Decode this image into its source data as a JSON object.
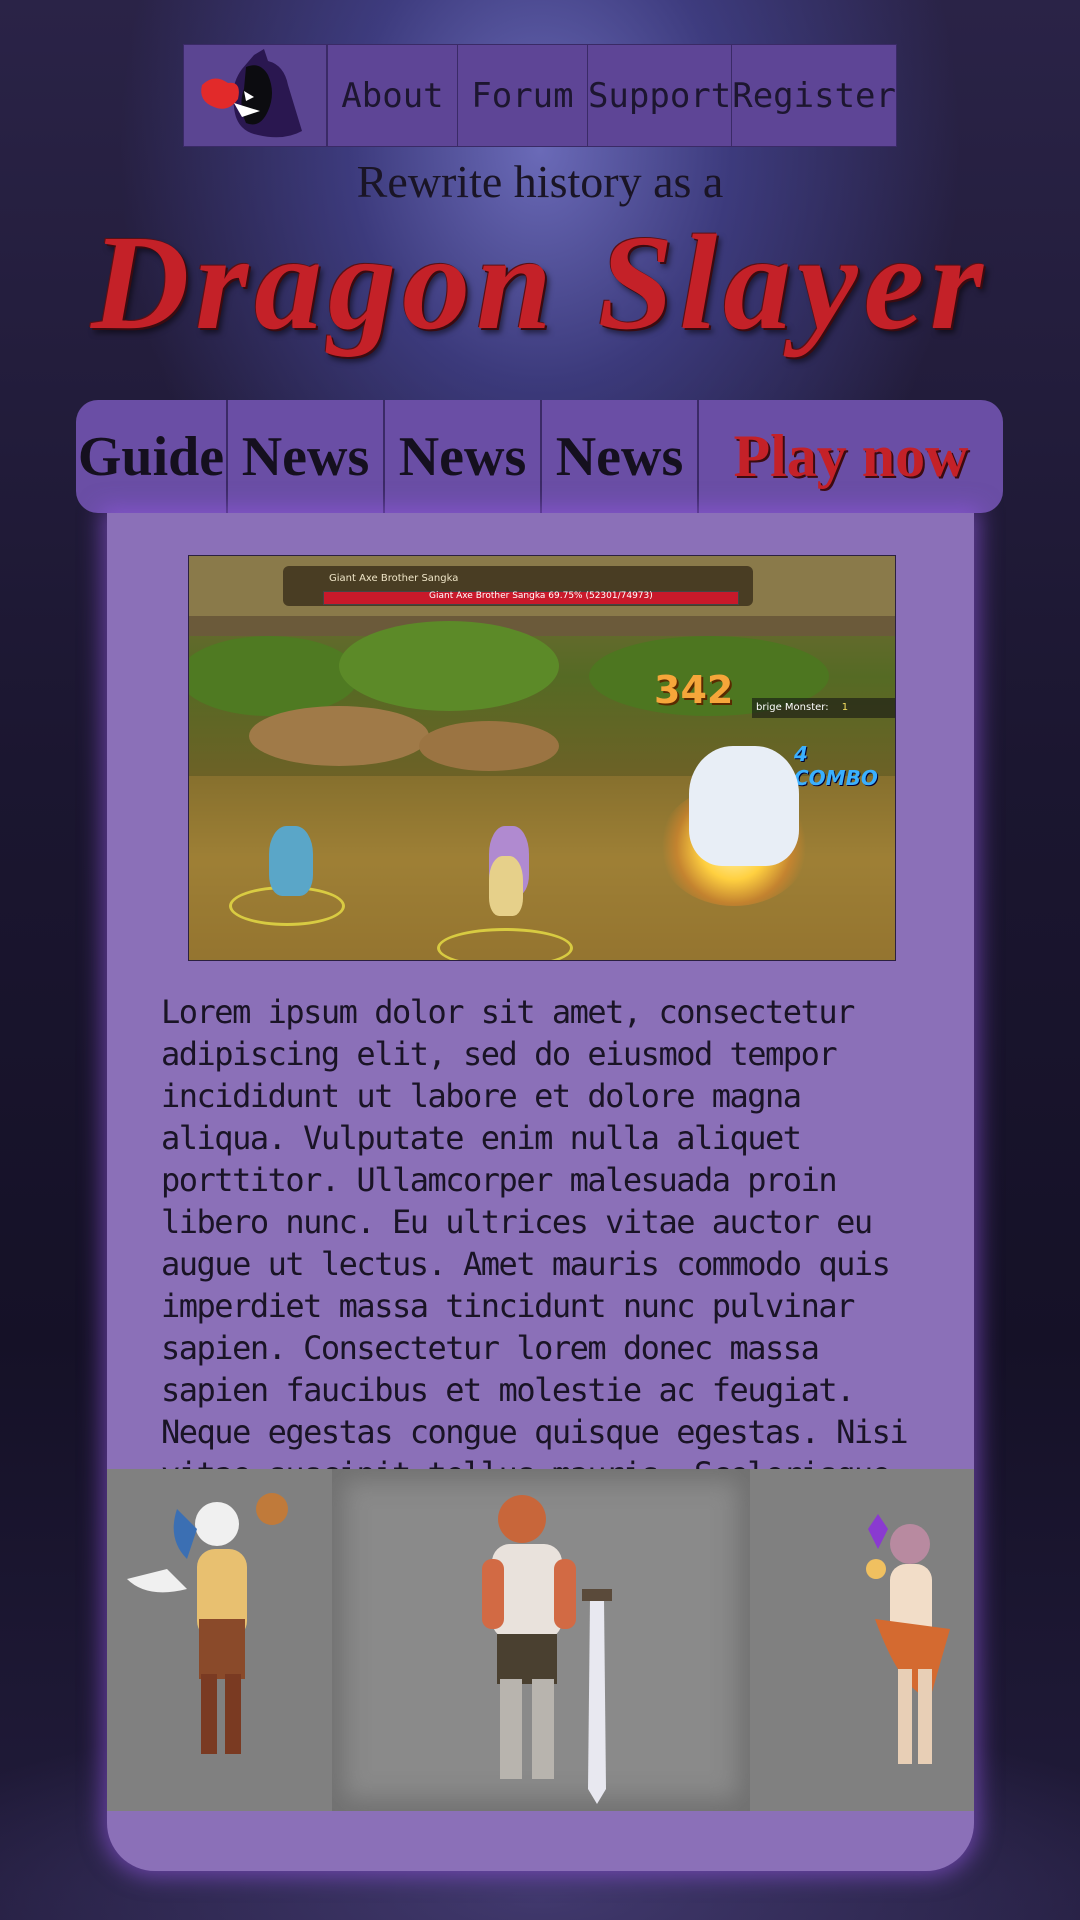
{
  "top_nav": {
    "items": [
      "About",
      "Forum",
      "Support",
      "Register"
    ]
  },
  "hero": {
    "tagline": "Rewrite history as a",
    "title": "Dragon Slayer"
  },
  "sub_nav": {
    "guide": "Guide",
    "news": [
      "News",
      "News",
      "News"
    ],
    "play": "Play now"
  },
  "screenshot": {
    "boss_name": "Giant Axe Brother Sangka",
    "boss_hp": "Giant Axe Brother Sangka 69.75% (52301/74973)",
    "damage": "342",
    "monster_label": "brige Monster:",
    "monster_count": "1",
    "combo": "4 COMBO"
  },
  "body_text": "Lorem ipsum dolor sit amet, consectetur adipiscing elit, sed do eiusmod tempor incididunt ut labore et dolore magna aliqua. Vulputate enim nulla aliquet porttitor. Ullamcorper malesuada proin libero nunc. Eu ultrices vitae auctor eu augue ut lectus. Amet mauris commodo quis imperdiet massa tincidunt nunc pulvinar sapien. Consectetur lorem donec massa sapien faucibus et molestie ac feugiat. Neque egestas congue quisque egestas. Nisi vitae suscipit tellus mauris. Scelerisque in dictum non consectetur a erat nam at.",
  "colors": {
    "accent_red": "#c42128",
    "nav_purple": "#5e4596",
    "card_purple": "#8b70b8"
  },
  "icons": {
    "logo": "dragon-logo-icon"
  }
}
